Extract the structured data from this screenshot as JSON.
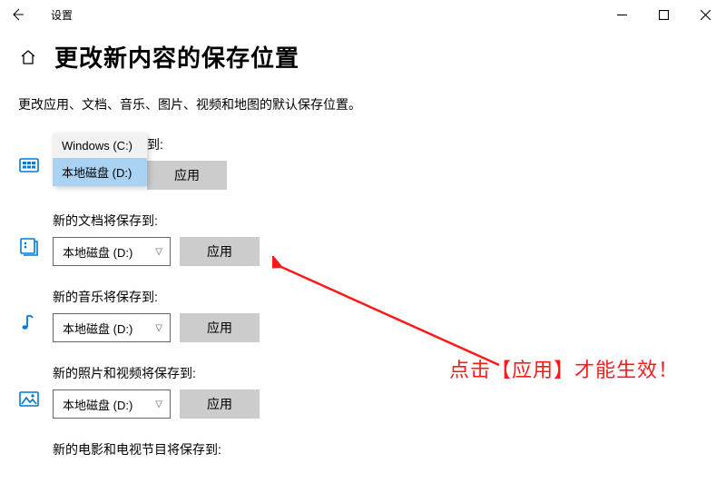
{
  "window": {
    "title": "设置"
  },
  "page": {
    "title": "更改新内容的保存位置",
    "subtitle": "更改应用、文档、音乐、图片、视频和地图的默认保存位置。"
  },
  "dropdown_options": [
    "Windows (C:)",
    "本地磁盘 (D:)"
  ],
  "rows": {
    "apps": {
      "label_suffix": "到:",
      "selected": "本地磁盘 (D:)",
      "apply": "应用"
    },
    "docs": {
      "label": "新的文档将保存到:",
      "selected": "本地磁盘 (D:)",
      "apply": "应用"
    },
    "music": {
      "label": "新的音乐将保存到:",
      "selected": "本地磁盘 (D:)",
      "apply": "应用"
    },
    "photos": {
      "label": "新的照片和视频将保存到:",
      "selected": "本地磁盘 (D:)",
      "apply": "应用"
    },
    "movies": {
      "label": "新的电影和电视节目将保存到:"
    }
  },
  "annotation": "点击【应用】才能生效！"
}
